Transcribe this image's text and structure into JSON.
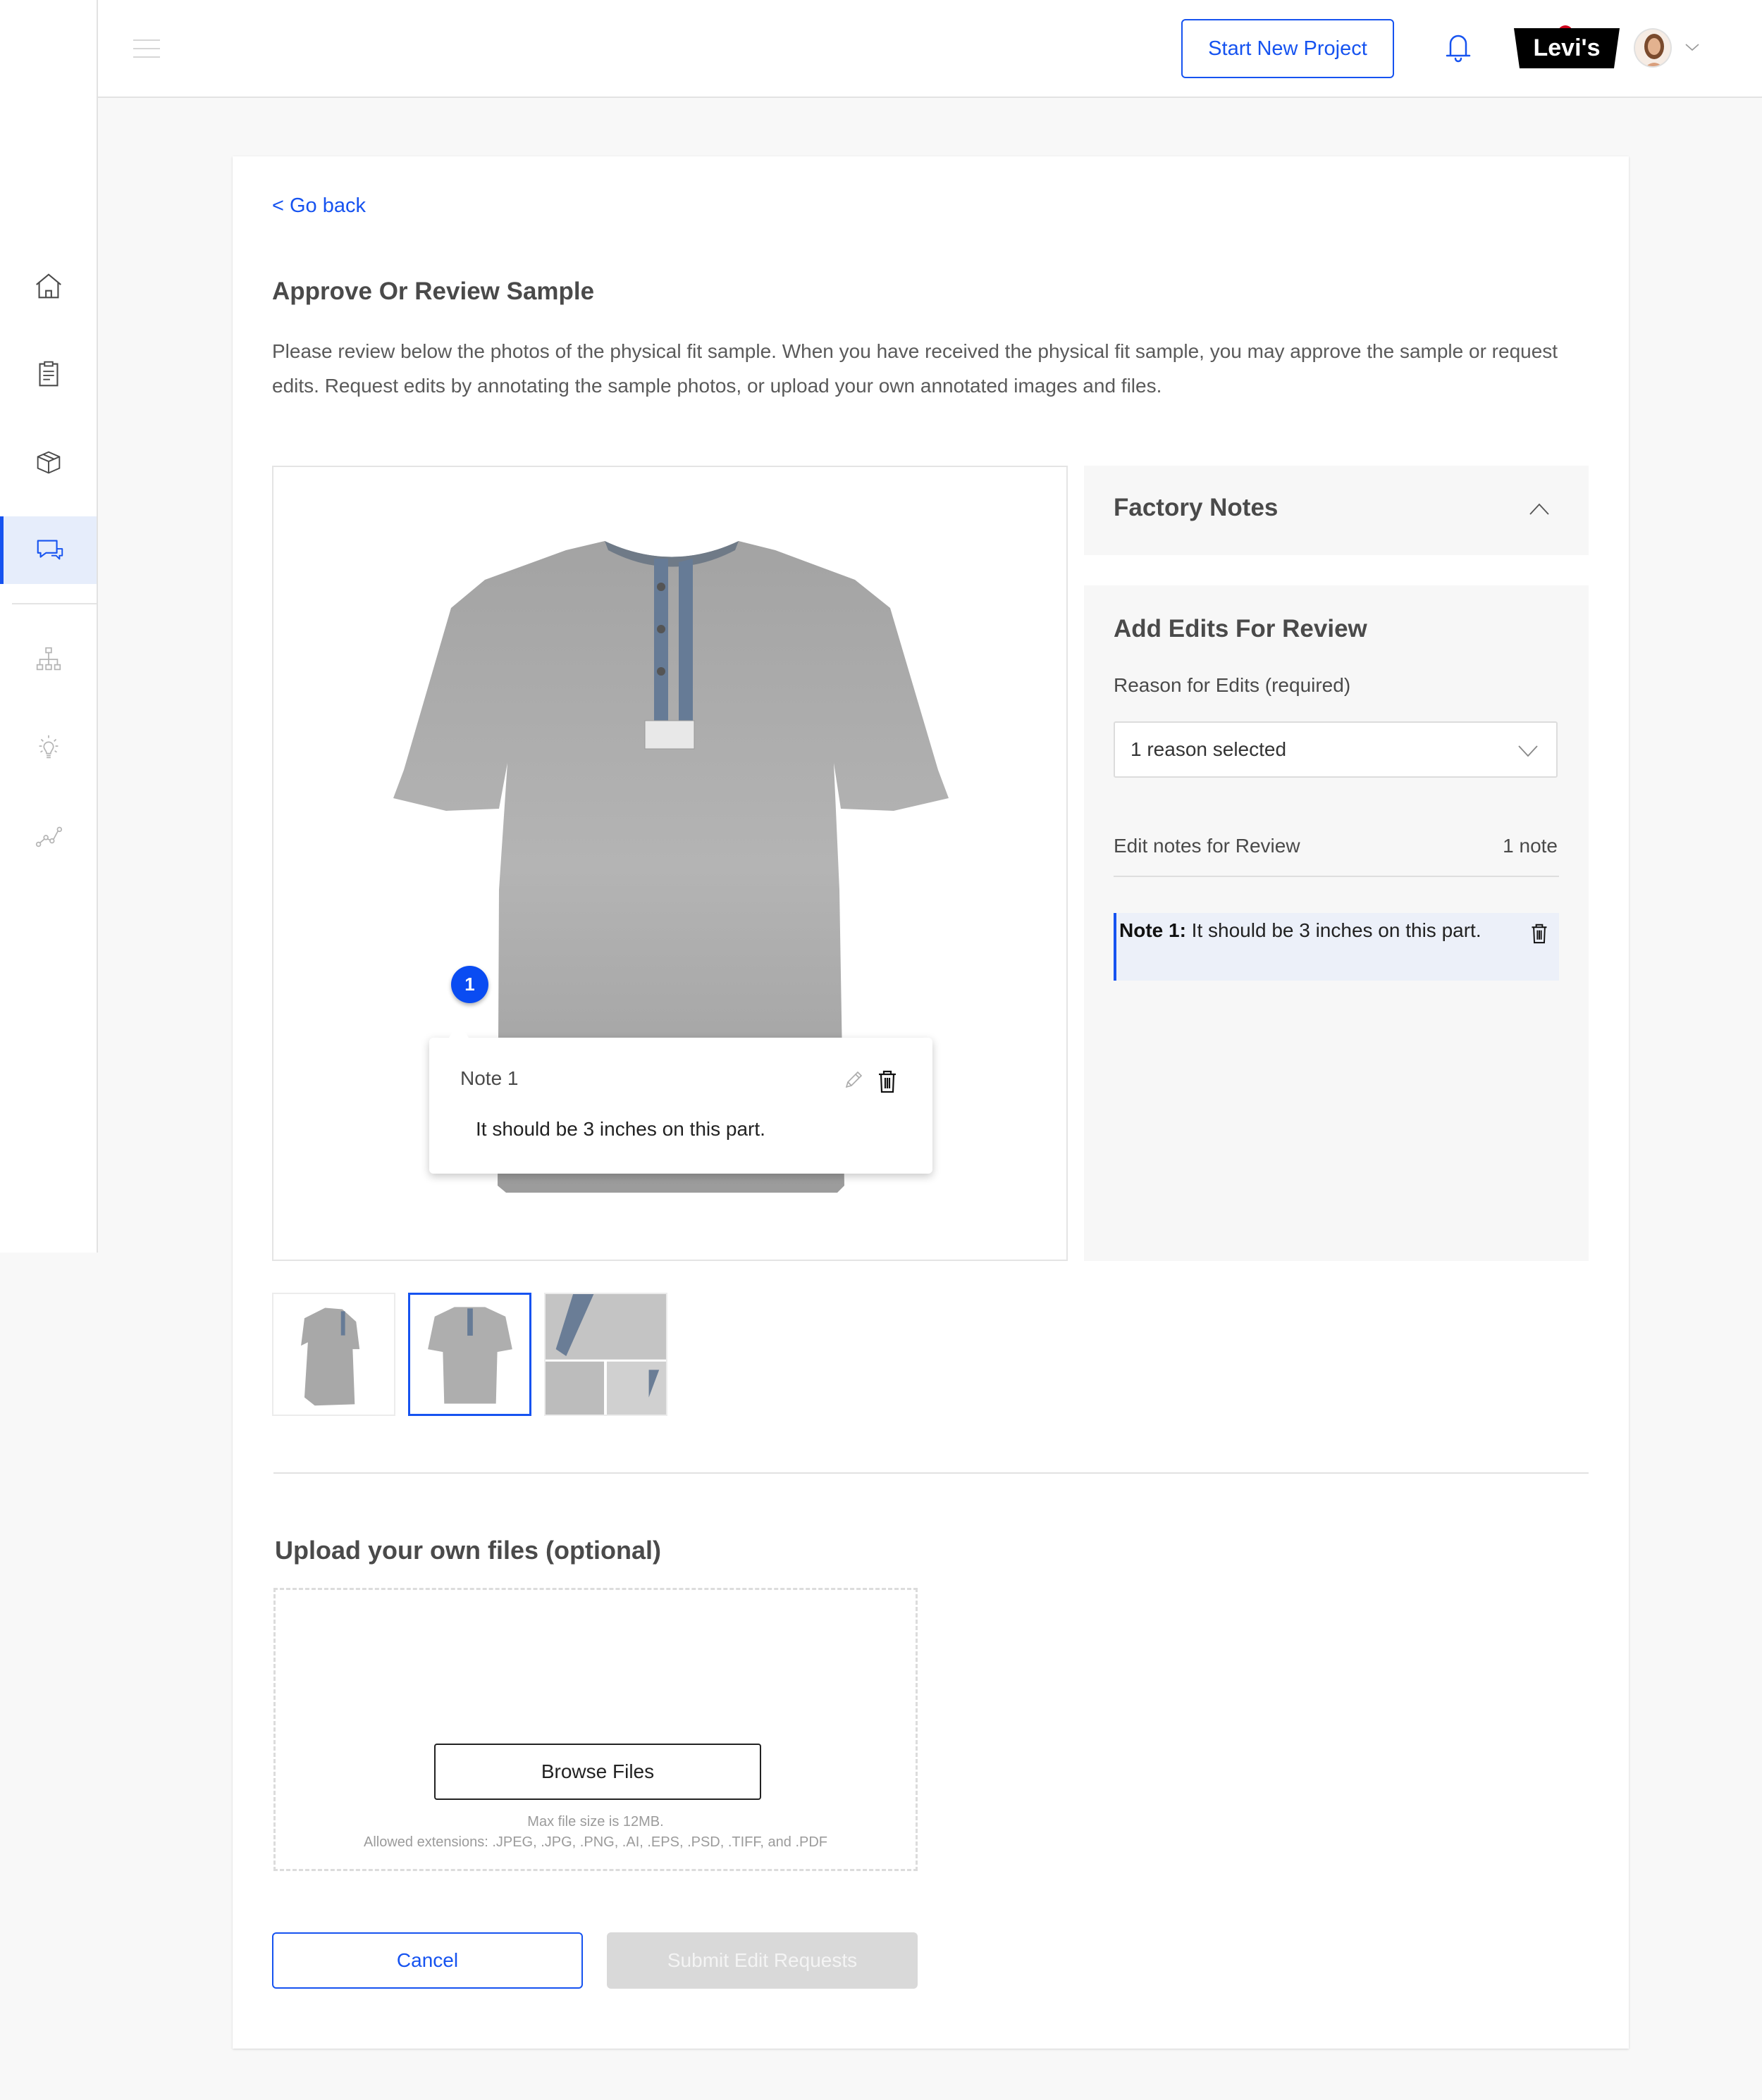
{
  "header": {
    "start_new_project_label": "Start New Project",
    "brand_logo_text": "Levi's",
    "notification_badge": true
  },
  "sidebar": {
    "items": [
      {
        "icon": "home-icon",
        "active": false
      },
      {
        "icon": "clipboard-icon",
        "active": false
      },
      {
        "icon": "box-icon",
        "active": false
      },
      {
        "icon": "chat-icon",
        "active": true
      },
      {
        "icon": "sitemap-icon",
        "active": false
      },
      {
        "icon": "lightbulb-icon",
        "active": false
      },
      {
        "icon": "line-chart-icon",
        "active": false
      }
    ]
  },
  "page": {
    "go_back": "< Go back",
    "title": "Approve Or Review Sample",
    "description": "Please review below the photos of the physical fit sample.  When you have received the physical fit sample, you may approve the sample or request edits.  Request edits by annotating the sample photos, or upload your own annotated images and files."
  },
  "viewer": {
    "marker_number": "1",
    "popover": {
      "title": "Note 1",
      "body": "It should be 3 inches on this part."
    },
    "thumbnails": [
      {
        "name": "side-view",
        "selected": false
      },
      {
        "name": "front-view",
        "selected": true
      },
      {
        "name": "detail-collage",
        "selected": false
      }
    ]
  },
  "factory_notes": {
    "title": "Factory Notes",
    "expanded": true
  },
  "edits": {
    "title": "Add Edits For Review",
    "reason_label": "Reason for Edits (required)",
    "reason_value": "1 reason selected",
    "notes_label": "Edit notes for Review",
    "notes_count": "1 note",
    "notes": [
      {
        "label": "Note 1:",
        "text": " It should be 3 inches on this part."
      }
    ]
  },
  "upload": {
    "title": "Upload your own files (optional)",
    "browse_label": "Browse Files",
    "max_size": "Max file size is 12MB.",
    "extensions": "Allowed extensions: .JPEG, .JPG, .PNG, .AI, .EPS, .PSD, .TIFF, and .PDF"
  },
  "actions": {
    "cancel_label": "Cancel",
    "submit_label": "Submit Edit Requests",
    "submit_disabled": true
  },
  "colors": {
    "accent": "#1653f0",
    "marker": "#0a4cf2",
    "notification": "#d0021b",
    "disabled_button": "#d9d9d9",
    "panel_bg": "#f7f7f7",
    "note_highlight": "#ecf0f9"
  }
}
